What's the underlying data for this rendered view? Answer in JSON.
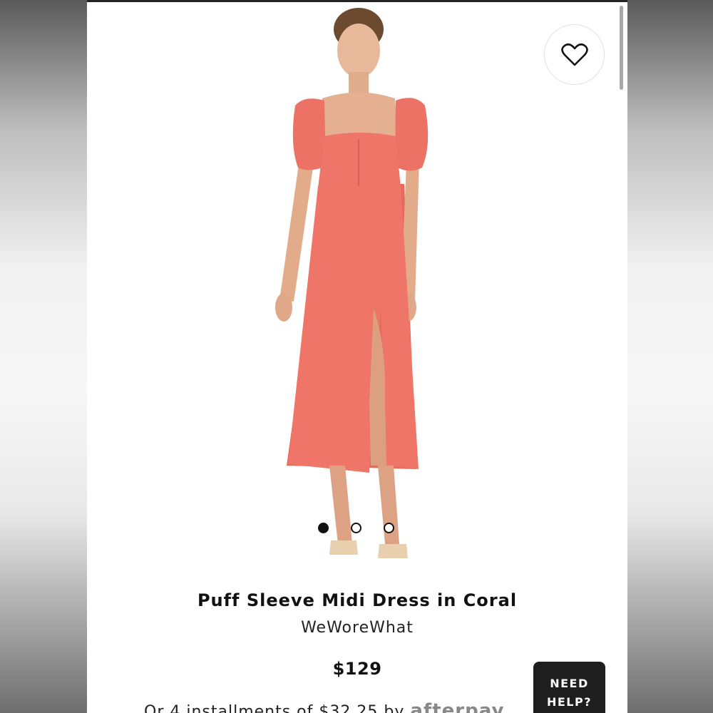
{
  "product": {
    "title": "Puff Sleeve Midi Dress in Coral",
    "brand": "WeWoreWhat",
    "price": "$129",
    "installments_text": "Or 4 installments of $32.25 by",
    "installments_provider": "afterpay"
  },
  "gallery": {
    "image_count": 3,
    "active_index": 0
  },
  "help": {
    "line1": "NEED",
    "line2": "HELP?"
  },
  "icons": {
    "favorite": "heart-outline-icon"
  },
  "colors": {
    "dress": "#ee7568",
    "help_bg": "#1e1e1e",
    "text": "#111111"
  }
}
